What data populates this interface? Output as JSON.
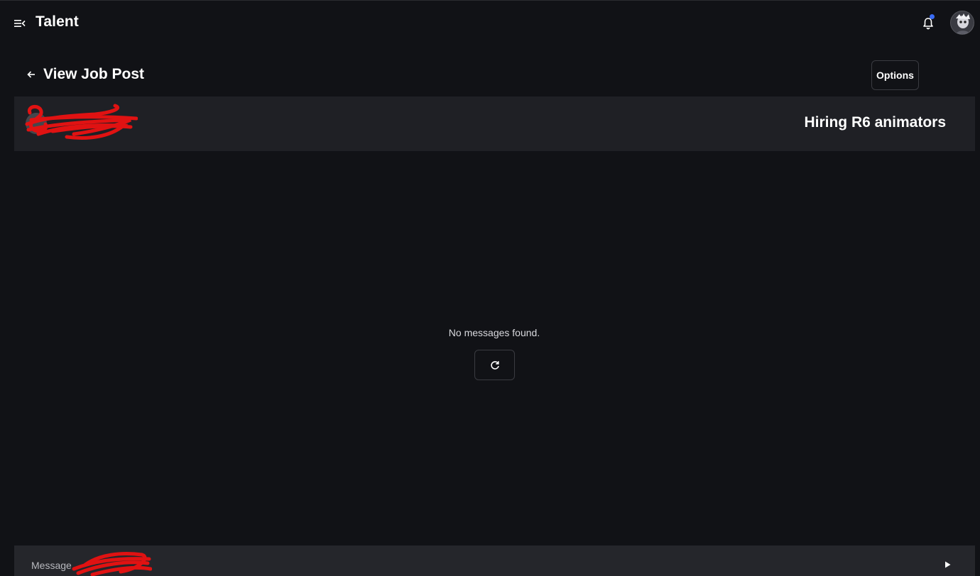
{
  "header": {
    "app_title": "Talent",
    "menu_icon": "menu-collapse-icon",
    "notification_icon": "bell-icon",
    "notification_dot_color": "#3a6cf5"
  },
  "page": {
    "title": "View Job Post",
    "back_icon": "arrow-left-icon",
    "options_label": "Options"
  },
  "post": {
    "title": "Hiring R6 animators",
    "poster_redacted": true,
    "redaction_color": "#e01212"
  },
  "messages": {
    "empty_text": "No messages found.",
    "refresh_icon": "refresh-icon"
  },
  "composer": {
    "placeholder": "Message",
    "send_icon": "send-icon"
  }
}
